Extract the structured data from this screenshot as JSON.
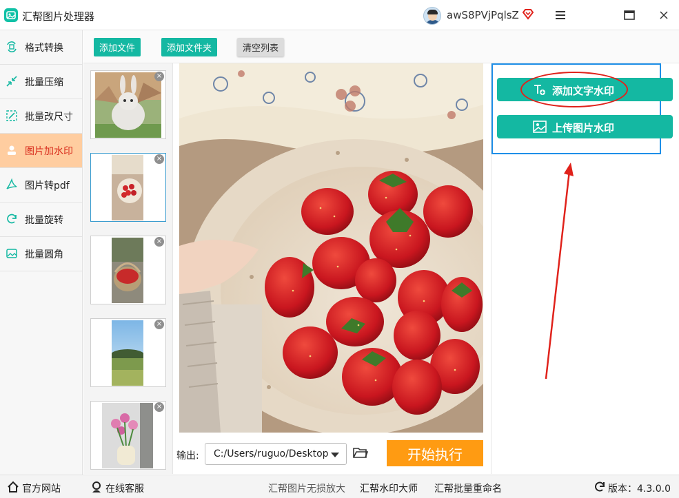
{
  "titlebar": {
    "app_title": "汇帮图片处理器",
    "username": "awS8PVjPqlsZ",
    "icons": [
      "app-logo",
      "user-avatar",
      "vip-badge-icon",
      "menu-icon",
      "maximize-icon",
      "close-icon"
    ]
  },
  "sidebar": {
    "items": [
      {
        "label": "格式转换",
        "icon": "format-convert-icon",
        "active": false
      },
      {
        "label": "批量压缩",
        "icon": "compress-icon",
        "active": false
      },
      {
        "label": "批量改尺寸",
        "icon": "resize-icon",
        "active": false
      },
      {
        "label": "图片加水印",
        "icon": "watermark-icon",
        "active": true
      },
      {
        "label": "图片转pdf",
        "icon": "pdf-icon",
        "active": false
      },
      {
        "label": "批量旋转",
        "icon": "rotate-icon",
        "active": false
      },
      {
        "label": "批量圆角",
        "icon": "rounded-corner-icon",
        "active": false
      }
    ]
  },
  "toolbar": {
    "add_file": "添加文件",
    "add_folder": "添加文件夹",
    "clear_list": "清空列表"
  },
  "thumbnails": [
    {
      "subject": "rabbit",
      "selected": false
    },
    {
      "subject": "strawberry-plate",
      "selected": true
    },
    {
      "subject": "strawberry-basket",
      "selected": false
    },
    {
      "subject": "landscape",
      "selected": false
    },
    {
      "subject": "tulips-vase",
      "selected": false
    }
  ],
  "output": {
    "label": "输出:",
    "path": "C:/Users/ruguo/Desktop",
    "start_button": "开始执行"
  },
  "watermark_panel": {
    "add_text_watermark": "添加文字水印",
    "upload_image_watermark": "上传图片水印"
  },
  "footer": {
    "official_site": "官方网站",
    "online_support": "在线客服",
    "link1": "汇帮图片无损放大",
    "link2": "汇帮水印大师",
    "link3": "汇帮批量重命名",
    "version": "版本：4.3.0.0"
  },
  "colors": {
    "accent_teal": "#14b8a2",
    "active_nav_bg": "#ffcda0",
    "active_nav_text": "#d82b1b",
    "start_orange": "#ff9b12",
    "annotation_blue": "#1e8fe8",
    "annotation_red": "#e0221b"
  }
}
